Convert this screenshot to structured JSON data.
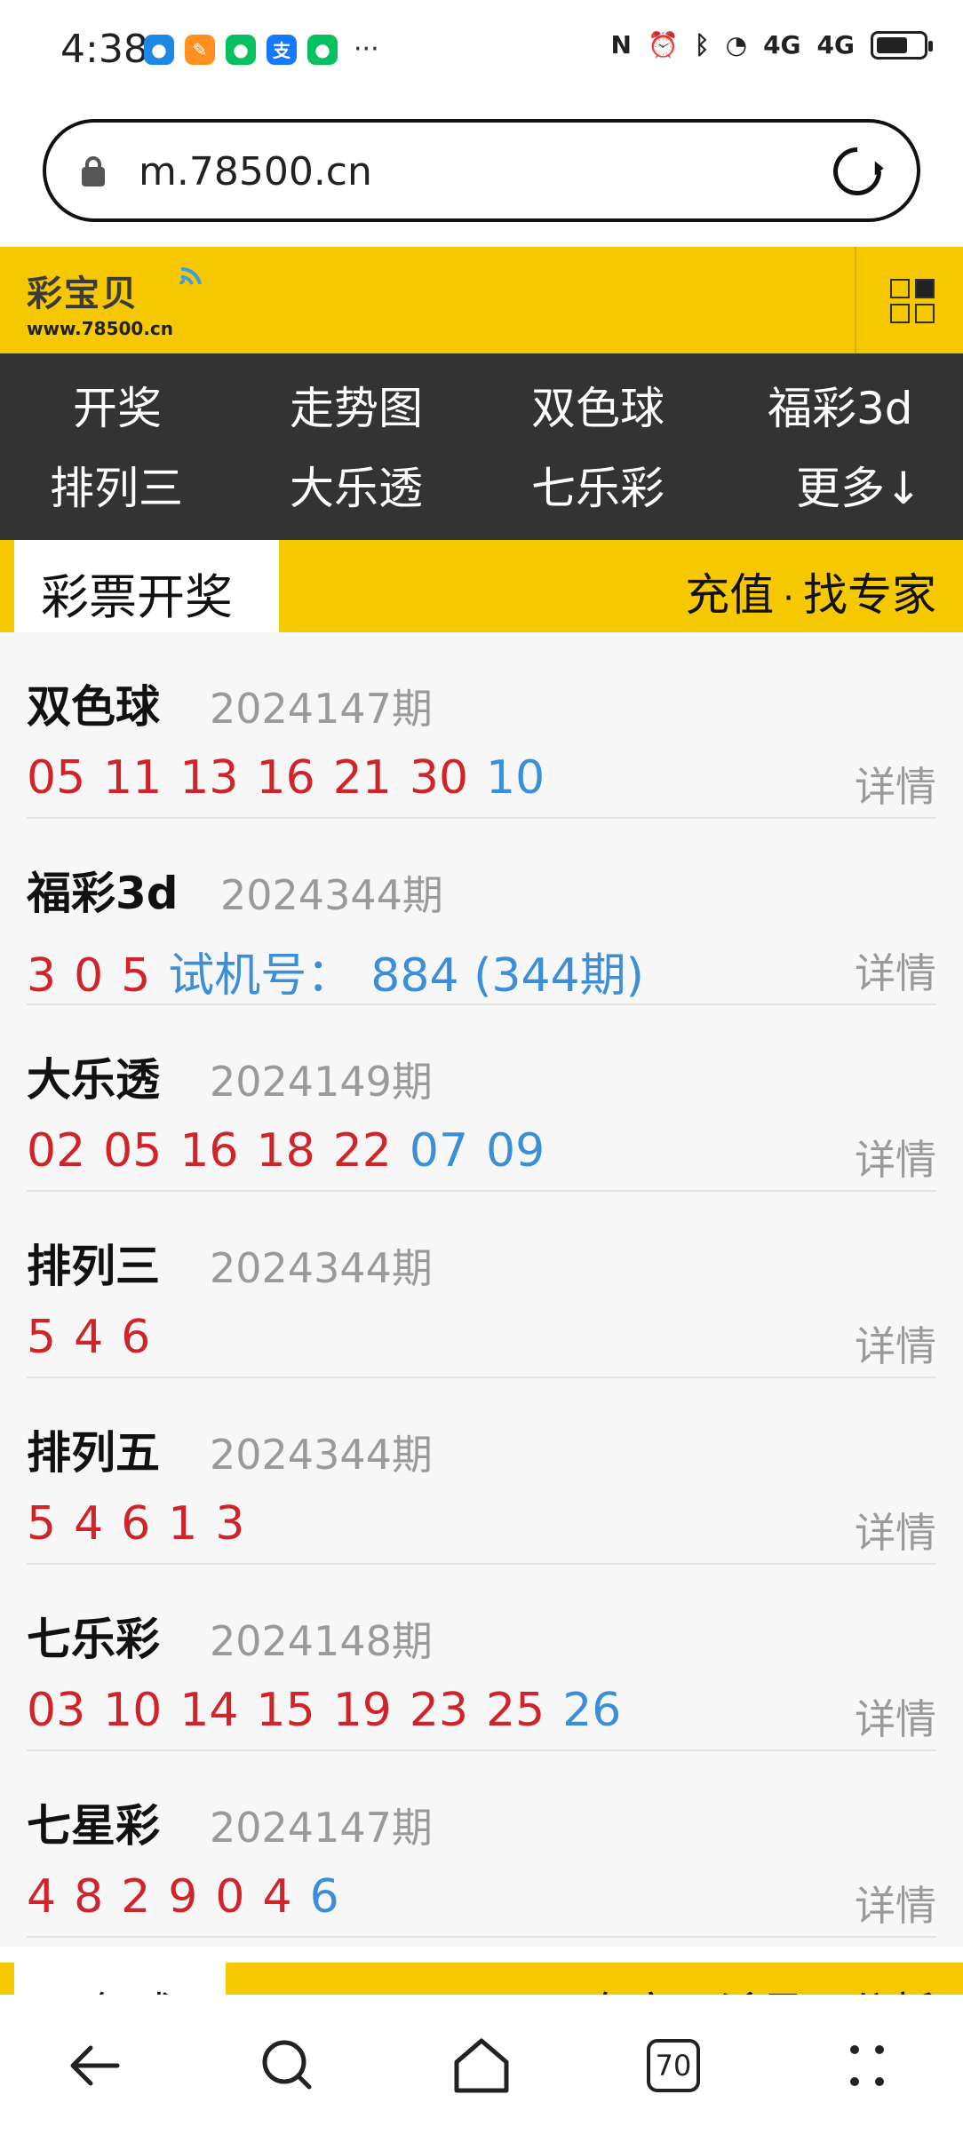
{
  "status_bar": {
    "time": "4:38",
    "apps": [
      {
        "name": "message-app-icon",
        "color": "#1e88e5",
        "glyph": "●"
      },
      {
        "name": "shopping-app-icon",
        "color": "#ff8f1f",
        "glyph": "✎"
      },
      {
        "name": "wechat-icon",
        "color": "#07c160",
        "glyph": "●"
      },
      {
        "name": "alipay-icon",
        "color": "#1677ff",
        "glyph": "支"
      },
      {
        "name": "wechat-icon-2",
        "color": "#07c160",
        "glyph": "●"
      }
    ],
    "more": "···",
    "right_icons": [
      "nfc-icon",
      "alarm-icon",
      "bluetooth-icon",
      "wifi-icon",
      "signal-4g-icon",
      "signal-4g-icon-2"
    ],
    "right_labels": [
      "N",
      "⏰",
      "ᛒ",
      "◔",
      "4G",
      "4G"
    ]
  },
  "browser": {
    "url": "m.78500.cn"
  },
  "site": {
    "logo_text": "彩宝贝",
    "logo_url": "www.78500.cn",
    "brand_color": "#f5c800"
  },
  "nav": {
    "items": [
      {
        "label": "开奖"
      },
      {
        "label": "走势图"
      },
      {
        "label": "双色球"
      },
      {
        "label": "福彩3d"
      },
      {
        "label": "排列三"
      },
      {
        "label": "大乐透"
      },
      {
        "label": "七乐彩"
      },
      {
        "label": "更多↓"
      }
    ]
  },
  "section": {
    "title": "彩票开奖",
    "link_recharge": "充值",
    "separator": "·",
    "link_expert": "找专家"
  },
  "lotteries": [
    {
      "name": "双色球",
      "issue": "2024147期",
      "numbers": [
        {
          "v": "05",
          "c": "red"
        },
        {
          "v": "11",
          "c": "red"
        },
        {
          "v": "13",
          "c": "red"
        },
        {
          "v": "16",
          "c": "red"
        },
        {
          "v": "21",
          "c": "red"
        },
        {
          "v": "30",
          "c": "red"
        },
        {
          "v": "10",
          "c": "blue"
        }
      ],
      "detail": "详情"
    },
    {
      "name": "福彩3d",
      "issue": "2024344期",
      "numbers": [
        {
          "v": "3",
          "c": "red"
        },
        {
          "v": "0",
          "c": "red"
        },
        {
          "v": "5",
          "c": "red"
        },
        {
          "v": "试机号：",
          "c": "blue"
        },
        {
          "v": "884 (344期)",
          "c": "blue"
        }
      ],
      "detail": "详情"
    },
    {
      "name": "大乐透",
      "issue": "2024149期",
      "numbers": [
        {
          "v": "02",
          "c": "red"
        },
        {
          "v": "05",
          "c": "red"
        },
        {
          "v": "16",
          "c": "red"
        },
        {
          "v": "18",
          "c": "red"
        },
        {
          "v": "22",
          "c": "red"
        },
        {
          "v": "07",
          "c": "blue"
        },
        {
          "v": "09",
          "c": "blue"
        }
      ],
      "detail": "详情"
    },
    {
      "name": "排列三",
      "issue": "2024344期",
      "numbers": [
        {
          "v": "5",
          "c": "red"
        },
        {
          "v": "4",
          "c": "red"
        },
        {
          "v": "6",
          "c": "red"
        }
      ],
      "detail": "详情"
    },
    {
      "name": "排列五",
      "issue": "2024344期",
      "numbers": [
        {
          "v": "5",
          "c": "red"
        },
        {
          "v": "4",
          "c": "red"
        },
        {
          "v": "6",
          "c": "red"
        },
        {
          "v": "1",
          "c": "red"
        },
        {
          "v": "3",
          "c": "red"
        }
      ],
      "detail": "详情"
    },
    {
      "name": "七乐彩",
      "issue": "2024148期",
      "numbers": [
        {
          "v": "03",
          "c": "red"
        },
        {
          "v": "10",
          "c": "red"
        },
        {
          "v": "14",
          "c": "red"
        },
        {
          "v": "15",
          "c": "red"
        },
        {
          "v": "19",
          "c": "red"
        },
        {
          "v": "23",
          "c": "red"
        },
        {
          "v": "25",
          "c": "red"
        },
        {
          "v": "26",
          "c": "blue"
        }
      ],
      "detail": "详情"
    },
    {
      "name": "七星彩",
      "issue": "2024147期",
      "numbers": [
        {
          "v": "4",
          "c": "red"
        },
        {
          "v": "8",
          "c": "red"
        },
        {
          "v": "2",
          "c": "red"
        },
        {
          "v": "9",
          "c": "red"
        },
        {
          "v": "0",
          "c": "red"
        },
        {
          "v": "4",
          "c": "red"
        },
        {
          "v": "6",
          "c": "blue"
        }
      ],
      "detail": "详情"
    }
  ],
  "next_section": {
    "title": "双色球",
    "links": "专家 · 杀号 · 分析"
  },
  "bottom_nav": {
    "tabs_count": "70"
  }
}
